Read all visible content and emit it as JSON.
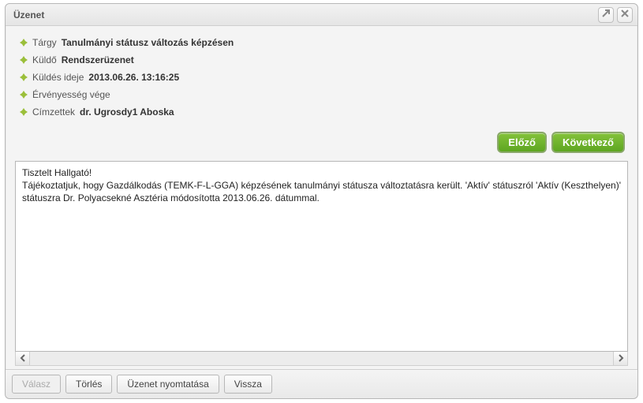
{
  "dialog": {
    "title": "Üzenet"
  },
  "meta": {
    "subject_label": "Tárgy",
    "subject_value": "Tanulmányi státusz változás képzésen",
    "sender_label": "Küldő",
    "sender_value": "Rendszerüzenet",
    "sent_label": "Küldés ideje",
    "sent_value": "2013.06.26. 13:16:25",
    "validity_label": "Érvényesség vége",
    "validity_value": "",
    "recipients_label": "Címzettek",
    "recipients_value": "dr. Ugrosdy1 Aboska"
  },
  "nav": {
    "prev": "Előző",
    "next": "Következő"
  },
  "message": {
    "greeting": "Tisztelt Hallgató!",
    "body": "Tájékoztatjuk, hogy Gazdálkodás (TEMK-F-L-GGA) képzésének tanulmányi státusza változtatásra került. 'Aktív' státuszról 'Aktív (Keszthelyen)' státuszra Dr. Polyacsekné Asztéria módosította 2013.06.26. dátummal."
  },
  "footer": {
    "reply": "Válasz",
    "delete": "Törlés",
    "print": "Üzenet nyomtatása",
    "back": "Vissza"
  }
}
